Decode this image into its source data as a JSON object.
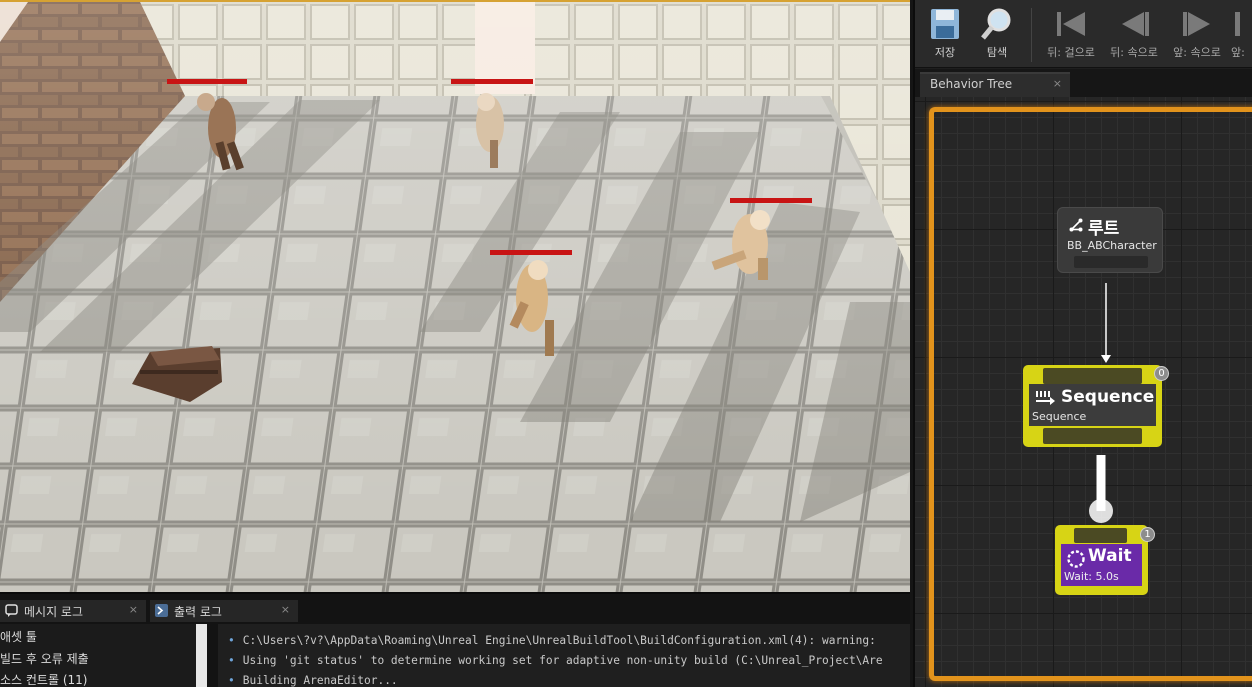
{
  "toolbar": {
    "items": [
      {
        "label": "저장",
        "icon": "save-icon"
      },
      {
        "label": "탐색",
        "icon": "search-icon"
      },
      {
        "label": "뒤: 걸으로",
        "icon": "step-back-icon"
      },
      {
        "label": "뒤: 속으로",
        "icon": "step-back-into-icon"
      },
      {
        "label": "앞: 속으로",
        "icon": "step-forward-into-icon"
      },
      {
        "label": "앞:",
        "icon": "step-forward-icon"
      }
    ]
  },
  "editor_tab": {
    "label": "Behavior Tree",
    "close": "×"
  },
  "nodes": {
    "root": {
      "title": "루트",
      "subtitle": "BB_ABCharacter"
    },
    "sequence": {
      "title": "Sequence",
      "subtitle": "Sequence",
      "index": "0"
    },
    "wait": {
      "title": "Wait",
      "subtitle": "Wait: 5.0s",
      "index": "1"
    }
  },
  "bottom_tabs": [
    {
      "label": "메시지 로그",
      "close": "×"
    },
    {
      "label": "출력 로그",
      "close": "×"
    }
  ],
  "categories": [
    "애셋 툴",
    "빌드 후 오류 제출",
    "소스 컨트롤 (11)"
  ],
  "log_lines": [
    "C:\\Users\\?v?\\AppData\\Roaming\\Unreal Engine\\UnrealBuildTool\\BuildConfiguration.xml(4): warning:",
    "Using 'git status' to determine working set for adaptive non-unity build (C:\\Unreal_Project\\Are",
    "Building ArenaEditor..."
  ],
  "colors": {
    "accent_orange": "#e2931c",
    "node_yellow": "#d7d415",
    "task_purple": "#6a2aa8",
    "health_bar_red": "#c81414"
  }
}
